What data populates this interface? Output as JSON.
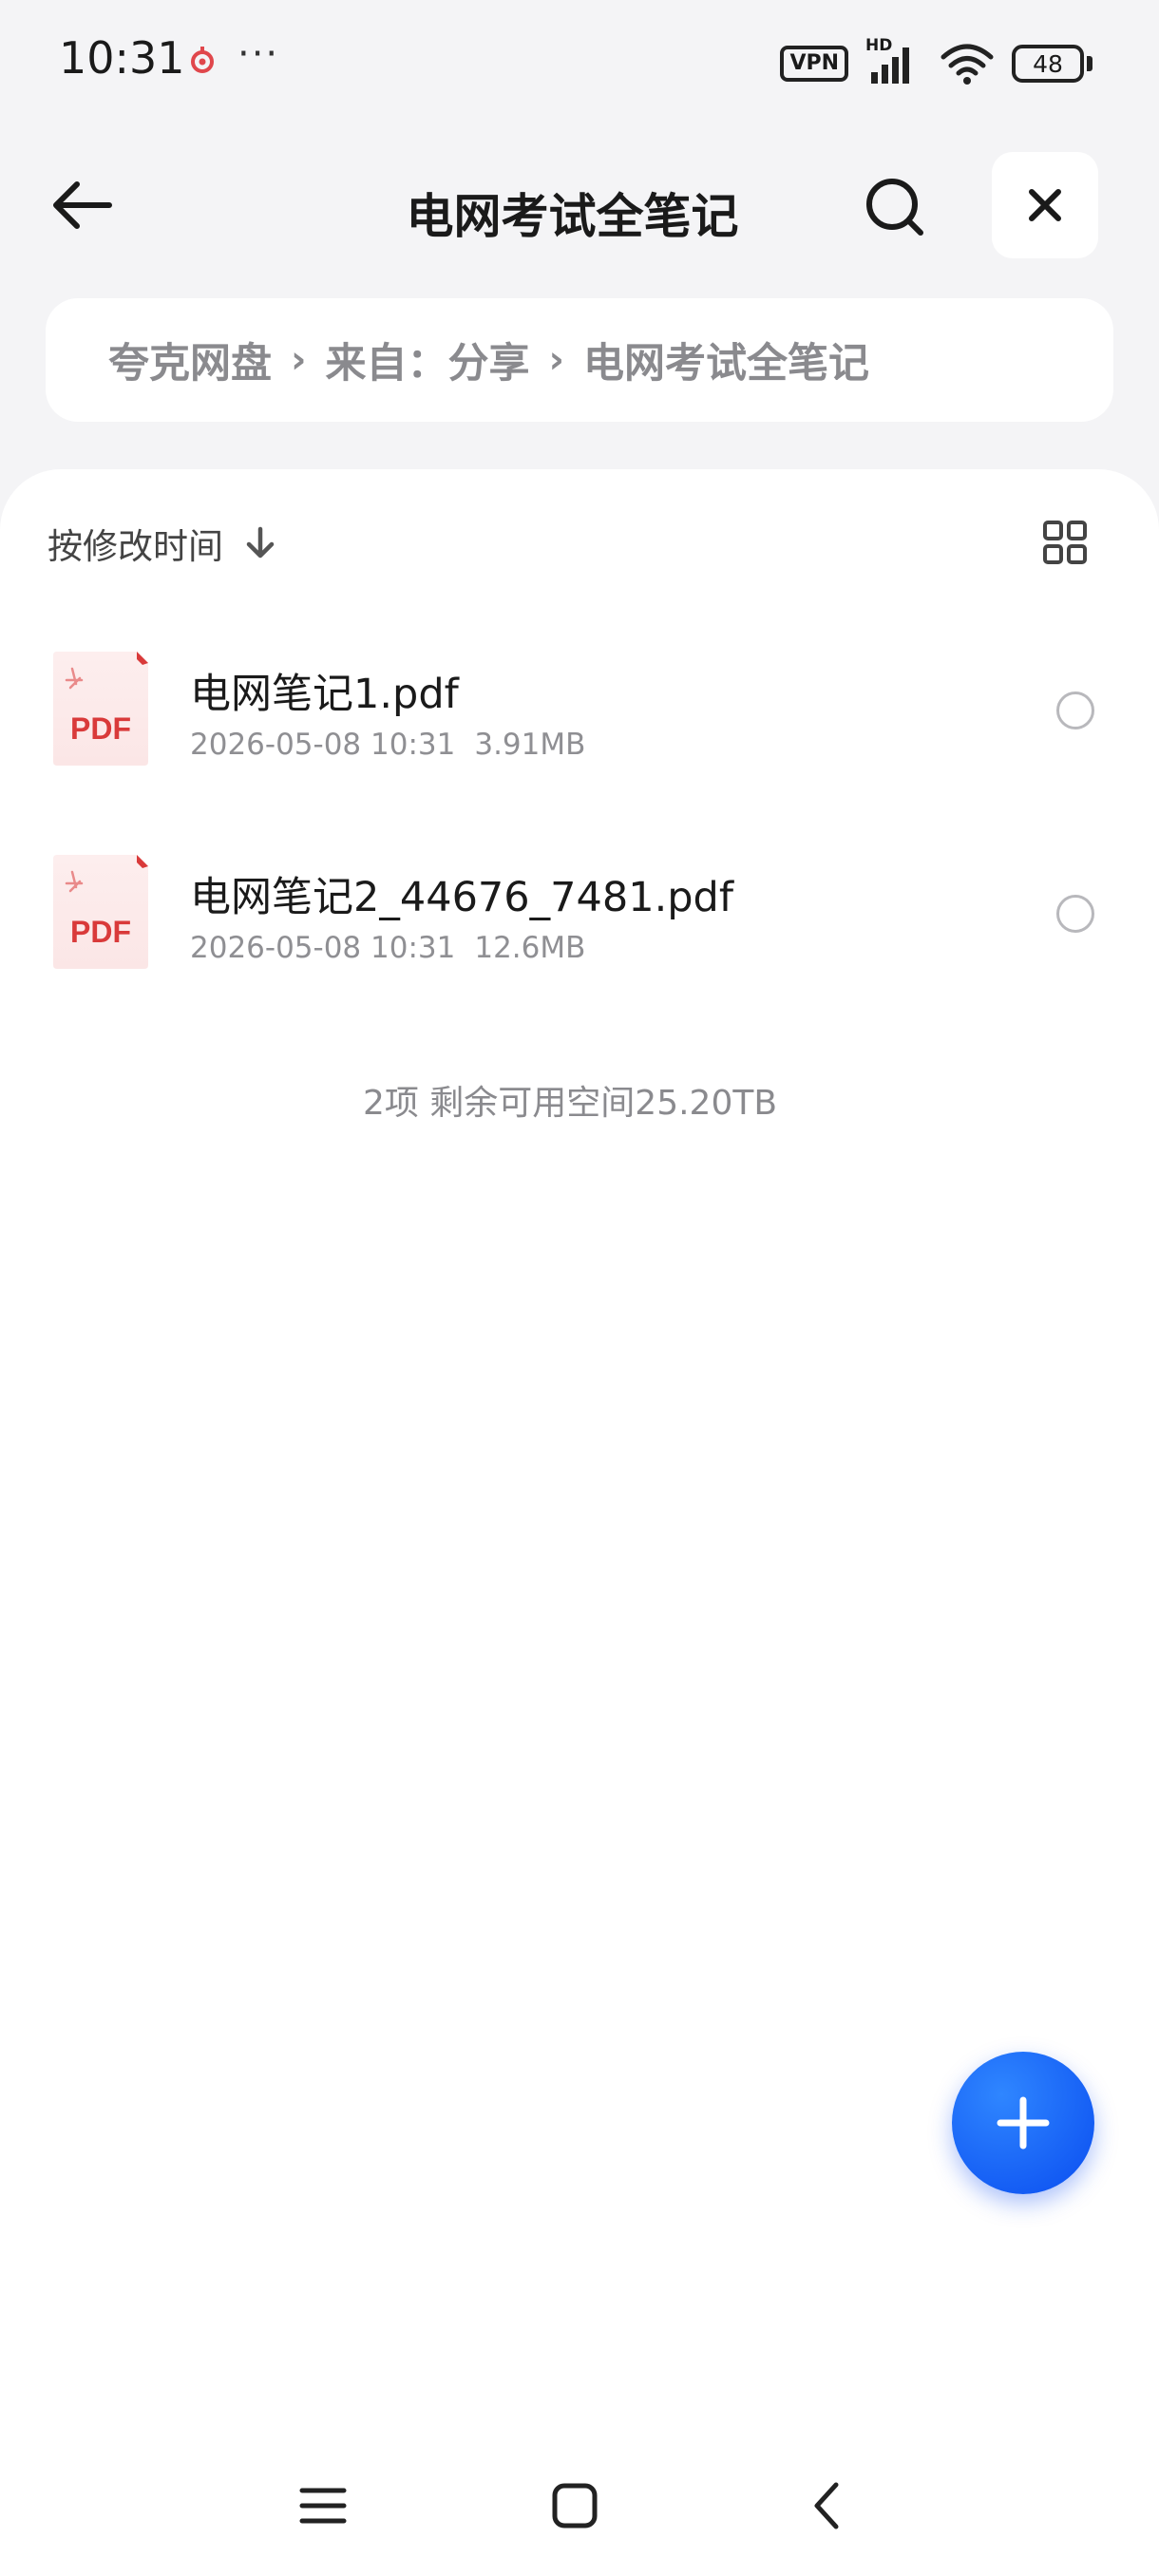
{
  "status_bar": {
    "time": "10:31",
    "more": "···",
    "vpn": "VPN",
    "network": "HD",
    "battery": "48"
  },
  "header": {
    "title": "电网考试全笔记"
  },
  "breadcrumb": [
    "夸克网盘",
    "来自：分享",
    "电网考试全笔记"
  ],
  "sort": {
    "label": "按修改时间"
  },
  "files": [
    {
      "icon_label": "PDF",
      "name": "电网笔记1.pdf",
      "date": "2026-05-08 10:31",
      "size": "3.91MB"
    },
    {
      "icon_label": "PDF",
      "name": "电网笔记2_44676_7481.pdf",
      "date": "2026-05-08 10:31",
      "size": "12.6MB"
    }
  ],
  "summary": "2项 剩余可用空间25.20TB",
  "colors": {
    "accent": "#0a4df0",
    "pdf_red": "#d93a3a",
    "background": "#f4f4f6"
  },
  "icons": {
    "back": "arrow-left-icon",
    "search": "search-icon",
    "close": "close-icon",
    "sort": "arrow-down-icon",
    "view": "grid-view-icon",
    "fab": "plus-icon",
    "nav": [
      "menu-icon",
      "home-icon",
      "back-chevron-icon"
    ]
  }
}
